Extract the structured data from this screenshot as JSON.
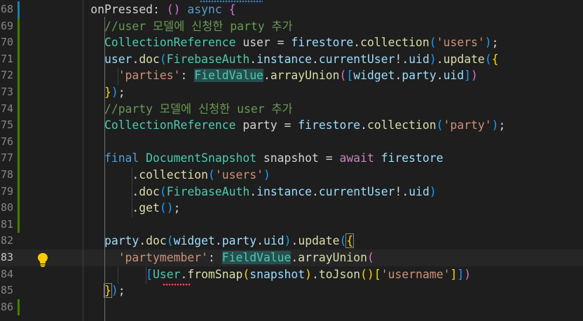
{
  "editor": {
    "colors": {
      "background": "#1e1e1e",
      "keyword": "#569cd6",
      "control": "#c586c0",
      "function": "#dcdcaa",
      "type": "#4ec9b0",
      "string": "#ce9178",
      "variable": "#9cdcfe",
      "comment": "#6a9955"
    },
    "current_line": "83",
    "lines": [
      {
        "n": "68",
        "t": [
          [
            "      ",
            ""
          ],
          [
            "onPressed",
            ""
          ],
          [
            ": ",
            ""
          ],
          [
            "()",
            "b2"
          ],
          [
            " async ",
            "kw"
          ],
          [
            "{",
            "b2"
          ]
        ]
      },
      {
        "n": "69",
        "t": [
          [
            "        ",
            ""
          ],
          [
            "//user 모델에 신청한 party 추가",
            "cmt"
          ]
        ]
      },
      {
        "n": "70",
        "t": [
          [
            "        ",
            ""
          ],
          [
            "CollectionReference",
            "ty"
          ],
          [
            " user = ",
            ""
          ],
          [
            "firestore",
            "var"
          ],
          [
            ".",
            ""
          ],
          [
            "collection",
            "fn"
          ],
          [
            "(",
            "b3"
          ],
          [
            "'users'",
            "str"
          ],
          [
            ")",
            "b3"
          ],
          [
            ";",
            ""
          ]
        ]
      },
      {
        "n": "71",
        "t": [
          [
            "        ",
            ""
          ],
          [
            "user",
            "var"
          ],
          [
            ".",
            ""
          ],
          [
            "doc",
            "fn"
          ],
          [
            "(",
            "b3"
          ],
          [
            "FirebaseAuth",
            "ty"
          ],
          [
            ".",
            ""
          ],
          [
            "instance",
            "var"
          ],
          [
            ".",
            ""
          ],
          [
            "currentUser",
            "var"
          ],
          [
            "!.",
            ""
          ],
          [
            "uid",
            "var"
          ],
          [
            ")",
            "b3"
          ],
          [
            ".",
            ""
          ],
          [
            "update",
            "fn"
          ],
          [
            "(",
            "b3"
          ],
          [
            "{",
            "b1"
          ]
        ]
      },
      {
        "n": "72",
        "t": [
          [
            "          ",
            ""
          ],
          [
            "'parties'",
            "str"
          ],
          [
            ": ",
            ""
          ],
          [
            "FieldValue",
            "ty hl"
          ],
          [
            ".",
            ""
          ],
          [
            "arrayUnion",
            "fn"
          ],
          [
            "(",
            "b2"
          ],
          [
            "[",
            "b3"
          ],
          [
            "widget",
            "var"
          ],
          [
            ".",
            ""
          ],
          [
            "party",
            "var"
          ],
          [
            ".",
            ""
          ],
          [
            "uid",
            "var"
          ],
          [
            "]",
            "b3"
          ],
          [
            ")",
            "b2"
          ]
        ]
      },
      {
        "n": "73",
        "t": [
          [
            "        ",
            ""
          ],
          [
            "}",
            "b1"
          ],
          [
            ")",
            "b3"
          ],
          [
            ";",
            ""
          ]
        ]
      },
      {
        "n": "74",
        "t": [
          [
            "        ",
            ""
          ],
          [
            "//party 모델에 신청한 user 추가",
            "cmt"
          ]
        ]
      },
      {
        "n": "75",
        "t": [
          [
            "        ",
            ""
          ],
          [
            "CollectionReference",
            "ty"
          ],
          [
            " party = ",
            ""
          ],
          [
            "firestore",
            "var"
          ],
          [
            ".",
            ""
          ],
          [
            "collection",
            "fn"
          ],
          [
            "(",
            "b3"
          ],
          [
            "'party'",
            "str"
          ],
          [
            ")",
            "b3"
          ],
          [
            ";",
            ""
          ]
        ]
      },
      {
        "n": "76",
        "t": [
          [
            "",
            ""
          ]
        ]
      },
      {
        "n": "77",
        "t": [
          [
            "        ",
            ""
          ],
          [
            "final ",
            "kw"
          ],
          [
            "DocumentSnapshot",
            "ty"
          ],
          [
            " snapshot = ",
            ""
          ],
          [
            "await ",
            "ctrl"
          ],
          [
            "firestore",
            "var"
          ]
        ]
      },
      {
        "n": "78",
        "t": [
          [
            "            .",
            ""
          ],
          [
            "collection",
            "fn"
          ],
          [
            "(",
            "b3"
          ],
          [
            "'users'",
            "str"
          ],
          [
            ")",
            "b3"
          ]
        ]
      },
      {
        "n": "79",
        "t": [
          [
            "            .",
            ""
          ],
          [
            "doc",
            "fn"
          ],
          [
            "(",
            "b3"
          ],
          [
            "FirebaseAuth",
            "ty"
          ],
          [
            ".",
            ""
          ],
          [
            "instance",
            "var"
          ],
          [
            ".",
            ""
          ],
          [
            "currentUser",
            "var"
          ],
          [
            "!.",
            ""
          ],
          [
            "uid",
            "var"
          ],
          [
            ")",
            "b3"
          ]
        ]
      },
      {
        "n": "80",
        "t": [
          [
            "            .",
            ""
          ],
          [
            "get",
            "fn"
          ],
          [
            "()",
            "b3"
          ],
          [
            ";",
            ""
          ]
        ]
      },
      {
        "n": "81",
        "t": [
          [
            "",
            ""
          ]
        ]
      },
      {
        "n": "82",
        "t": [
          [
            "        ",
            ""
          ],
          [
            "party",
            "var"
          ],
          [
            ".",
            ""
          ],
          [
            "doc",
            "fn"
          ],
          [
            "(",
            "b3"
          ],
          [
            "widget",
            "var"
          ],
          [
            ".",
            ""
          ],
          [
            "party",
            "var"
          ],
          [
            ".",
            ""
          ],
          [
            "uid",
            "var"
          ],
          [
            ")",
            "b3"
          ],
          [
            ".",
            ""
          ],
          [
            "update",
            "fn"
          ],
          [
            "(",
            "b3"
          ],
          [
            "{",
            "b1 bm"
          ]
        ]
      },
      {
        "n": "83",
        "t": [
          [
            "          ",
            ""
          ],
          [
            "'partymember'",
            "str"
          ],
          [
            ": ",
            ""
          ],
          [
            "FieldValue",
            "ty hl"
          ],
          [
            ".",
            ""
          ],
          [
            "arrayUnion",
            "fn"
          ],
          [
            "(",
            "b2"
          ]
        ]
      },
      {
        "n": "84",
        "t": [
          [
            "              ",
            ""
          ],
          [
            "[",
            "b3"
          ],
          [
            "User",
            "ty"
          ],
          [
            ".",
            ""
          ],
          [
            "fromSnap",
            "fn"
          ],
          [
            "(",
            "b1"
          ],
          [
            "snapshot",
            "var"
          ],
          [
            ")",
            "b1"
          ],
          [
            ".",
            ""
          ],
          [
            "toJson",
            "fn"
          ],
          [
            "()",
            "b1"
          ],
          [
            "[",
            "b1"
          ],
          [
            "'username'",
            "str"
          ],
          [
            "]",
            "b1"
          ],
          [
            "]",
            "b3"
          ],
          [
            ")",
            "b2"
          ]
        ]
      },
      {
        "n": "85",
        "t": [
          [
            "        ",
            ""
          ],
          [
            "}",
            "b1 bm"
          ],
          [
            ")",
            "b3"
          ],
          [
            ";",
            ""
          ]
        ]
      },
      {
        "n": "86",
        "t": [
          [
            "",
            ""
          ]
        ]
      }
    ]
  }
}
